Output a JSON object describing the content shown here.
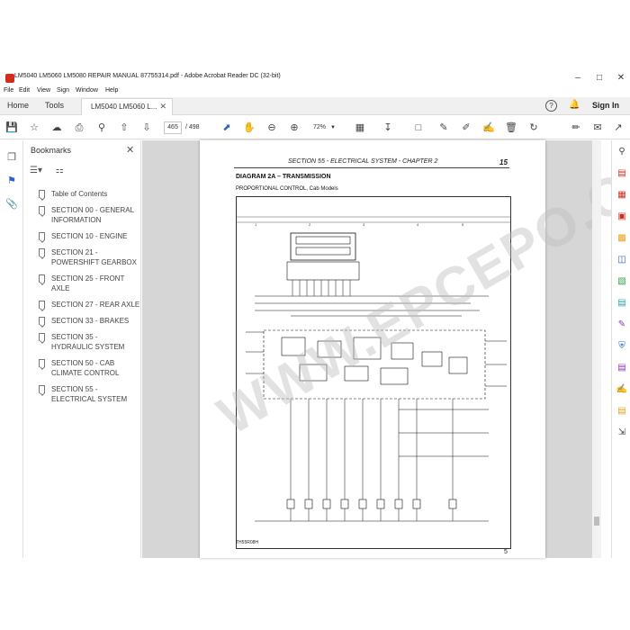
{
  "window": {
    "title": "LM5040 LM5060 LM5080 REPAIR MANUAL 87755314.pdf - Adobe Acrobat Reader DC (32-bit)"
  },
  "menu": [
    "File",
    "Edit",
    "View",
    "Sign",
    "Window",
    "Help"
  ],
  "tabs": {
    "home": "Home",
    "tools": "Tools",
    "document": "LM5040 LM5060 L..."
  },
  "account": {
    "sign_in": "Sign In"
  },
  "toolbar": {
    "page_current": "465",
    "page_total": "/ 498",
    "zoom": "72%"
  },
  "bookmarks": {
    "title": "Bookmarks",
    "items": [
      "Table of Contents",
      "SECTION 00 - GENERAL INFORMATION",
      "SECTION 10 - ENGINE",
      "SECTION 21 - POWERSHIFT GEARBOX",
      "SECTION 25 - FRONT AXLE",
      "SECTION 27 - REAR AXLE",
      "SECTION 33 - BRAKES",
      "SECTION 35 - HYDRAULIC SYSTEM",
      "SECTION 50 - CAB CLIMATE CONTROL",
      "SECTION 55 - ELECTRICAL SYSTEM"
    ]
  },
  "document_page": {
    "header": "SECTION 55 - ELECTRICAL SYSTEM - CHAPTER 2",
    "header_page": "15",
    "diagram_title": "DIAGRAM 2A – TRANSMISSION",
    "diagram_subtitle": "PROPORTIONAL CONTROL, Cab Models",
    "column_numbers": [
      "1",
      "2",
      "3",
      "4",
      "5"
    ],
    "diagram_code": "TH55R08H",
    "footer_page": "5",
    "watermark": "WWW.EPCEPO.COM"
  },
  "icons": {
    "app": "acrobat-icon",
    "left_rail": [
      "page-thumbnails-icon",
      "bookmark-icon",
      "attachment-icon"
    ],
    "right_rail": [
      "zoom-search-icon",
      "export-pdf-icon",
      "organize-pages-icon",
      "create-pdf-icon",
      "comment-icon",
      "combine-files-icon",
      "edit-pdf-icon",
      "scan-icon",
      "fill-sign-icon",
      "protect-icon",
      "print-production-icon",
      "send-for-signature-icon",
      "more-tools-icon",
      "expand-icon"
    ]
  },
  "colors": {
    "acrobat_red": "#d32b1e",
    "viewer_gray": "#d6d6d6",
    "select_blue": "#2a62c9"
  }
}
